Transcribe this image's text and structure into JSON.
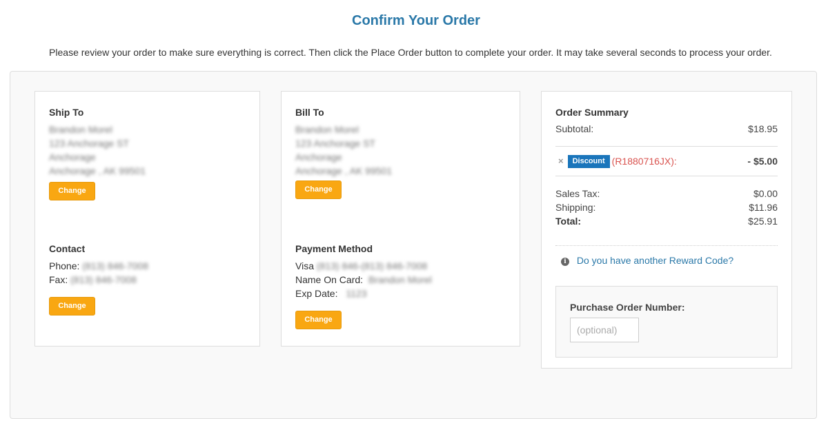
{
  "header": {
    "title": "Confirm Your Order",
    "intro": "Please review your order to make sure everything is correct. Then click the Place Order button to complete your order. It may take several seconds to process your order."
  },
  "ship_to": {
    "title": "Ship To",
    "lines": [
      "Brandon Morel",
      "123 Anchorage ST",
      "Anchorage",
      "Anchorage , AK 99501"
    ],
    "change_label": "Change"
  },
  "contact": {
    "title": "Contact",
    "phone_label": "Phone:",
    "phone_value": "(813) 846-7008",
    "fax_label": "Fax:",
    "fax_value": "(813) 846-7008",
    "change_label": "Change"
  },
  "bill_to": {
    "title": "Bill To",
    "lines": [
      "Brandon Morel",
      "123 Anchorage ST",
      "Anchorage",
      "Anchorage , AK 99501"
    ],
    "change_label": "Change"
  },
  "payment": {
    "title": "Payment Method",
    "card_label": "Visa",
    "card_value": "(813) 846-(813) 846-7008",
    "name_label": "Name On Card:",
    "name_value": "Brandon Morel",
    "exp_label": "Exp Date:",
    "exp_value": "1123",
    "change_label": "Change"
  },
  "summary": {
    "title": "Order Summary",
    "subtotal_label": "Subtotal:",
    "subtotal_value": "$18.95",
    "discount": {
      "remove_icon": "×",
      "badge": "Discount",
      "code": "(R1880716JX):",
      "value": "- $5.00"
    },
    "tax_label": "Sales Tax:",
    "tax_value": "$0.00",
    "shipping_label": "Shipping:",
    "shipping_value": "$11.96",
    "total_label": "Total:",
    "total_value": "$25.91",
    "reward_link": "Do you have another Reward Code?",
    "info_icon": "i",
    "po_label": "Purchase Order Number:",
    "po_placeholder": "(optional)",
    "po_value": ""
  },
  "colors": {
    "accent": "#2a78a8",
    "button": "#f9a712",
    "badge": "#1a75bb",
    "discount_code": "#d9534f"
  }
}
